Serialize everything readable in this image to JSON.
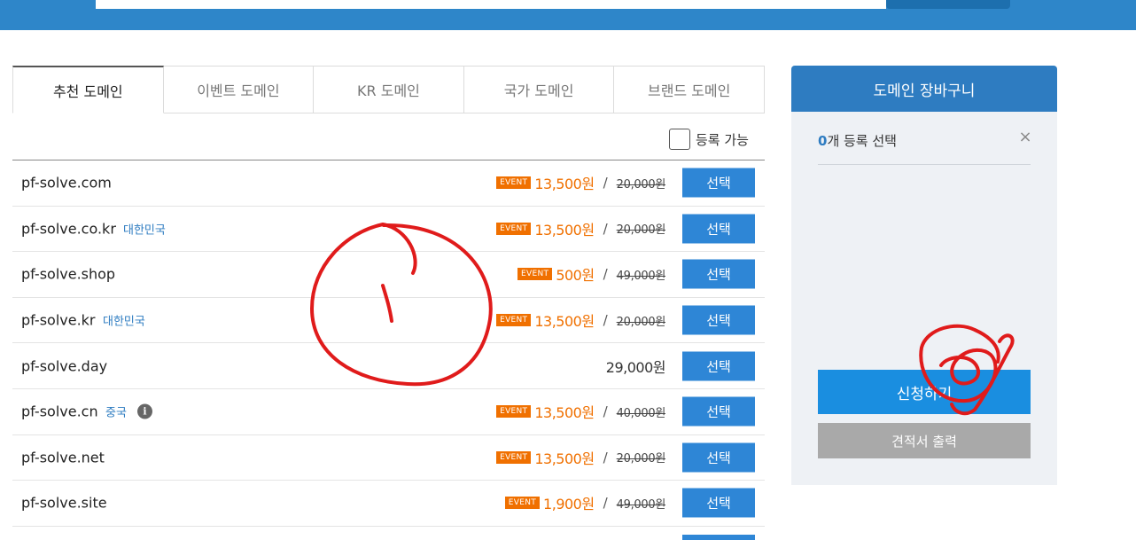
{
  "tabs": [
    {
      "label": "추천 도메인",
      "active": true
    },
    {
      "label": "이벤트 도메인",
      "active": false
    },
    {
      "label": "KR 도메인",
      "active": false
    },
    {
      "label": "국가 도메인",
      "active": false
    },
    {
      "label": "브랜드 도메인",
      "active": false
    }
  ],
  "filter": {
    "label": "등록 가능",
    "checked": false
  },
  "domains": [
    {
      "name": "pf-solve.com",
      "country": "",
      "info": false,
      "event": true,
      "badge": "EVENT",
      "price": "13,500원",
      "slash": "/",
      "original": "20,000원",
      "button": "선택"
    },
    {
      "name": "pf-solve.co.kr",
      "country": "대한민국",
      "info": false,
      "event": true,
      "badge": "EVENT",
      "price": "13,500원",
      "slash": "/",
      "original": "20,000원",
      "button": "선택"
    },
    {
      "name": "pf-solve.shop",
      "country": "",
      "info": false,
      "event": true,
      "badge": "EVENT",
      "price": "500원",
      "slash": "/",
      "original": "49,000원",
      "button": "선택"
    },
    {
      "name": "pf-solve.kr",
      "country": "대한민국",
      "info": false,
      "event": true,
      "badge": "EVENT",
      "price": "13,500원",
      "slash": "/",
      "original": "20,000원",
      "button": "선택"
    },
    {
      "name": "pf-solve.day",
      "country": "",
      "info": false,
      "event": false,
      "badge": "",
      "price": "29,000원",
      "slash": "",
      "original": "",
      "button": "선택"
    },
    {
      "name": "pf-solve.cn",
      "country": "중국",
      "info": true,
      "event": true,
      "badge": "EVENT",
      "price": "13,500원",
      "slash": "/",
      "original": "40,000원",
      "button": "선택"
    },
    {
      "name": "pf-solve.net",
      "country": "",
      "info": false,
      "event": true,
      "badge": "EVENT",
      "price": "13,500원",
      "slash": "/",
      "original": "20,000원",
      "button": "선택"
    },
    {
      "name": "pf-solve.site",
      "country": "",
      "info": false,
      "event": true,
      "badge": "EVENT",
      "price": "1,900원",
      "slash": "/",
      "original": "49,000원",
      "button": "선택"
    }
  ],
  "cart": {
    "title": "도메인 장바구니",
    "count": "0",
    "count_suffix": "개 등록 선택",
    "close_icon": "×",
    "apply_label": "신청하기",
    "quote_label": "견적서 출력"
  },
  "info_glyph": "i",
  "colors": {
    "primary": "#2e86c9",
    "event": "#f07000",
    "annotation": "#e01b1b"
  }
}
